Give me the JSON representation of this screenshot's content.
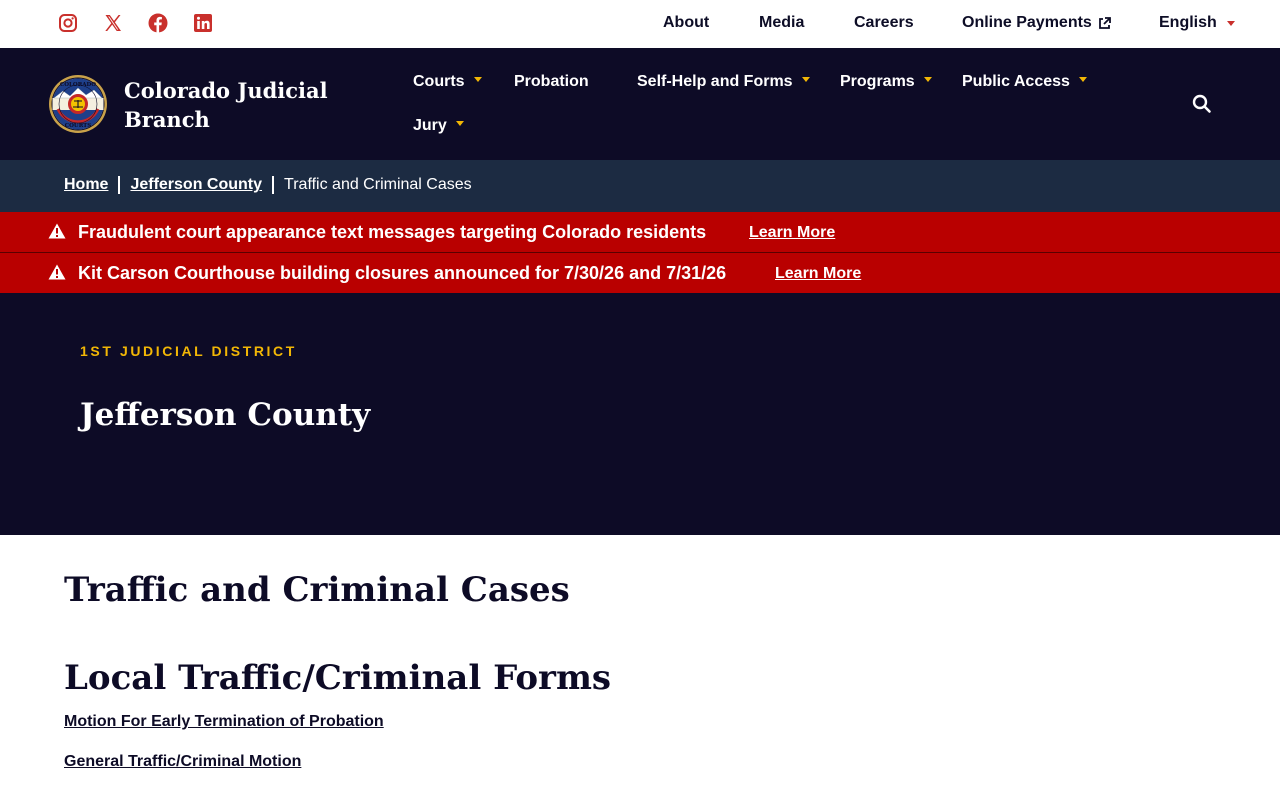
{
  "social": {
    "instagram_icon": "instagram-icon",
    "x_icon": "x-twitter-icon",
    "facebook_icon": "facebook-icon",
    "linkedin_icon": "linkedin-icon",
    "icon_color": "#c9302c"
  },
  "utility_nav": {
    "about": "About",
    "media": "Media",
    "careers": "Careers",
    "online_payments": "Online Payments",
    "language": "English"
  },
  "brand": {
    "name_line1": "Colorado Judicial",
    "name_line2": "Branch",
    "seal_top_text": "COLORADO",
    "seal_bottom_text": "COURTS"
  },
  "main_nav": {
    "courts": "Courts",
    "probation": "Probation",
    "self_help": "Self-Help and Forms",
    "programs": "Programs",
    "public_access": "Public Access",
    "jury": "Jury"
  },
  "breadcrumb": {
    "home": "Home",
    "county": "Jefferson County",
    "current": "Traffic and Criminal Cases"
  },
  "alerts": [
    {
      "text": "Fraudulent court appearance text messages targeting Colorado residents",
      "link": "Learn More"
    },
    {
      "text": "Kit Carson Courthouse building closures announced for 7/30/26 and 7/31/26",
      "link": "Learn More"
    }
  ],
  "hero": {
    "eyebrow": "1ST JUDICIAL DISTRICT",
    "title": "Jefferson County"
  },
  "content": {
    "page_title": "Traffic and Criminal Cases",
    "section_title": "Local Traffic/Criminal Forms",
    "links": [
      "Motion For Early Termination of Probation",
      "General Traffic/Criminal Motion"
    ]
  },
  "colors": {
    "navy": "#0d0b26",
    "breadcrumb_bg": "#1c2b42",
    "alert_red": "#b90000",
    "gold_accent": "#f2b705"
  }
}
